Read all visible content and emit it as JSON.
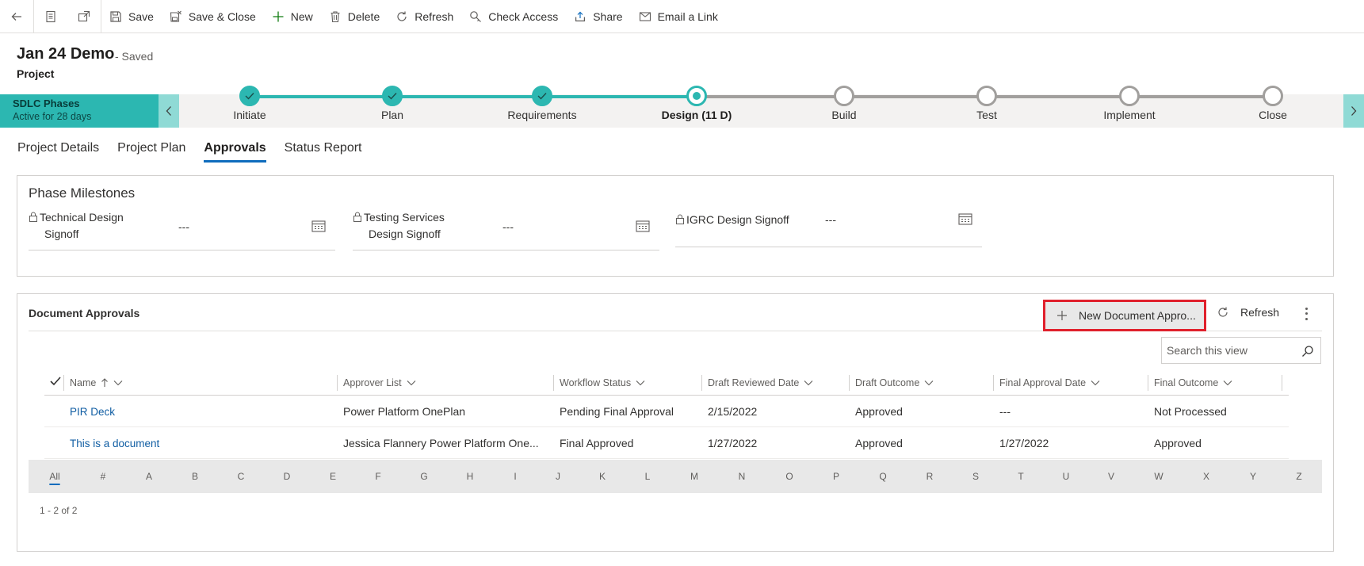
{
  "toolbar": {
    "save": "Save",
    "save_close": "Save & Close",
    "new": "New",
    "delete": "Delete",
    "refresh": "Refresh",
    "check_access": "Check Access",
    "share": "Share",
    "email_link": "Email a Link"
  },
  "header": {
    "title": "Jan 24 Demo",
    "status": "- Saved",
    "entity": "Project"
  },
  "process": {
    "name": "SDLC Phases",
    "active_for": "Active for 28 days",
    "stages": [
      {
        "label": "Initiate",
        "state": "done"
      },
      {
        "label": "Plan",
        "state": "done"
      },
      {
        "label": "Requirements",
        "state": "done"
      },
      {
        "label": "Design  (11 D)",
        "state": "active"
      },
      {
        "label": "Build",
        "state": "todo"
      },
      {
        "label": "Test",
        "state": "todo"
      },
      {
        "label": "Implement",
        "state": "todo"
      },
      {
        "label": "Close",
        "state": "todo"
      }
    ]
  },
  "tabs": [
    "Project Details",
    "Project Plan",
    "Approvals",
    "Status Report"
  ],
  "selected_tab": "Approvals",
  "milestones": {
    "title": "Phase Milestones",
    "fields": [
      {
        "label_line1": "Technical Design",
        "label_line2": "Signoff",
        "value": "---"
      },
      {
        "label_line1": "Testing Services",
        "label_line2": "Design Signoff",
        "value": "---"
      },
      {
        "label_line1": "IGRC Design Signoff",
        "label_line2": "",
        "value": "---"
      }
    ]
  },
  "approvals": {
    "title": "Document Approvals",
    "new_button": "New Document Appro...",
    "refresh": "Refresh",
    "search_placeholder": "Search this view",
    "columns": [
      "Name",
      "Approver List",
      "Workflow Status",
      "Draft Reviewed Date",
      "Draft Outcome",
      "Final Approval Date",
      "Final Outcome"
    ],
    "rows": [
      [
        "PIR Deck",
        "Power Platform OnePlan",
        "Pending Final Approval",
        "2/15/2022",
        "Approved",
        "---",
        "Not Processed"
      ],
      [
        "This is a document",
        "Jessica Flannery Power Platform One...",
        "Final Approved",
        "1/27/2022",
        "Approved",
        "1/27/2022",
        "Approved"
      ]
    ],
    "jump_letters": [
      "All",
      "#",
      "A",
      "B",
      "C",
      "D",
      "E",
      "F",
      "G",
      "H",
      "I",
      "J",
      "K",
      "L",
      "M",
      "N",
      "O",
      "P",
      "Q",
      "R",
      "S",
      "T",
      "U",
      "V",
      "W",
      "X",
      "Y",
      "Z"
    ],
    "pager": "1 - 2 of 2"
  },
  "colors": {
    "process_accent": "#2cb7b1",
    "link": "#115ea3",
    "highlight": "#e0202c"
  }
}
